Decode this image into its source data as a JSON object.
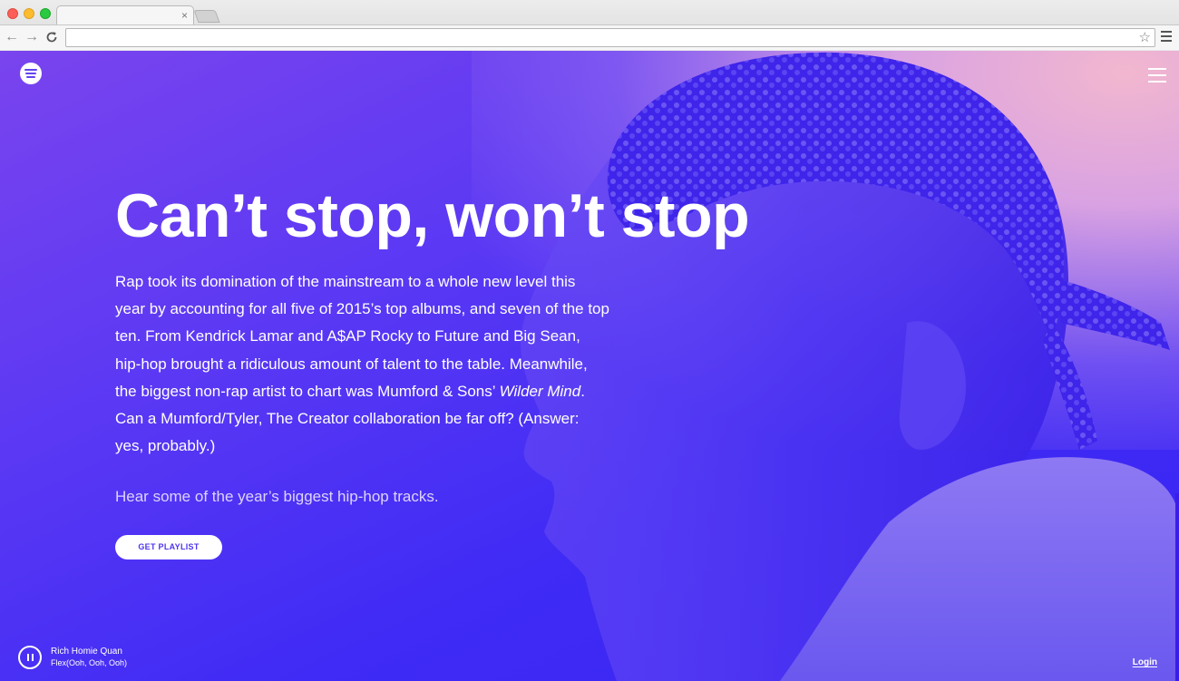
{
  "page": {
    "headline": "Can’t stop, won’t stop",
    "body_part1": "Rap took its domination of the mainstream to a whole new level this year by accounting for all five of 2015’s top albums, and seven of the top ten. From Kendrick Lamar and A$AP Rocky to Future and Big Sean, hip-hop brought a ridiculous amount of talent to the table. Meanwhile, the biggest non-rap artist to chart was Mumford & Sons’ ",
    "body_italic": "Wilder Mind",
    "body_part2": ". Can a Mumford/Tyler, The Creator collaboration be far off? (Answer: yes, probably.)",
    "subtext": "Hear some of the year’s biggest hip-hop tracks.",
    "cta_label": "GET PLAYLIST"
  },
  "player": {
    "artist": "Rich Homie Quan",
    "track": "Flex(Ooh, Ooh, Ooh)"
  },
  "footer": {
    "login_label": "Login"
  },
  "browser": {
    "tab_close": "×",
    "back_glyph": "←",
    "forward_glyph": "→",
    "reload_glyph": "C",
    "star_glyph": "☆"
  },
  "icons": {
    "logo": "spotify-logo-icon",
    "menu": "hamburger-menu-icon",
    "pause": "pause-icon"
  },
  "colors": {
    "accent": "#4e35ee",
    "background_dark": "#3a24f2",
    "background_glow": "#f2b7cf"
  }
}
